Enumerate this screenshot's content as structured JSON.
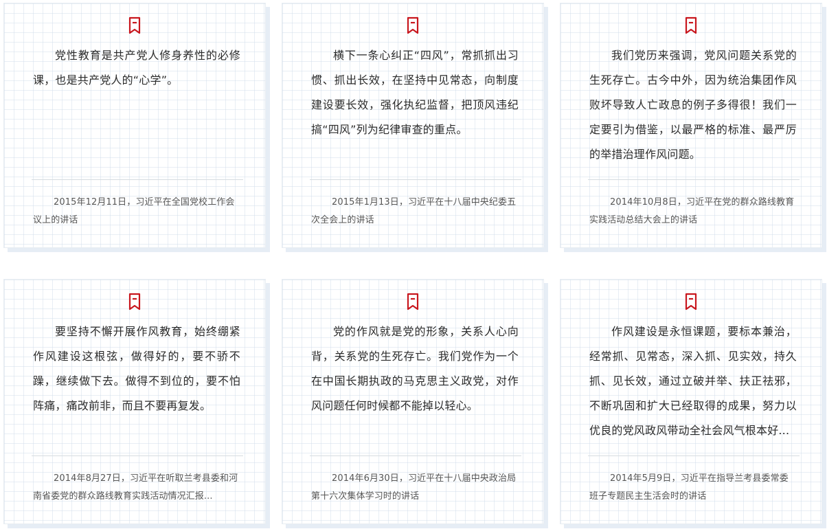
{
  "accent_color": "#c8161d",
  "icon": "bookmark-icon",
  "cards": [
    {
      "quote": "党性教育是共产党人修身养性的必修课，也是共产党人的“心学”。",
      "source": "2015年12月11日，习近平在全国党校工作会议上的讲话"
    },
    {
      "quote": "横下一条心纠正“四风”，常抓抓出习惯、抓出长效，在坚持中见常态，向制度建设要长效，强化执纪监督，把顶风违纪搞“四风”列为纪律审查的重点。",
      "source": "2015年1月13日，习近平在十八届中央纪委五次全会上的讲话"
    },
    {
      "quote": "我们党历来强调，党风问题关系党的生死存亡。古今中外，因为统治集团作风败坏导致人亡政息的例子多得很！我们一定要引为借鉴，以最严格的标准、最严厉的举措治理作风问题。",
      "source": "2014年10月8日，习近平在党的群众路线教育实践活动总结大会上的讲话"
    },
    {
      "quote": "要坚持不懈开展作风教育，始终绷紧作风建设这根弦，做得好的，要不骄不躁，继续做下去。做得不到位的，要不怕阵痛，痛改前非，而且不要再复发。",
      "source": "2014年8月27日，习近平在听取兰考县委和河南省委党的群众路线教育实践活动情况汇报..."
    },
    {
      "quote": "党的作风就是党的形象，关系人心向背，关系党的生死存亡。我们党作为一个在中国长期执政的马克思主义政党，对作风问题任何时候都不能掉以轻心。",
      "source": "2014年6月30日，习近平在十八届中央政治局第十六次集体学习时的讲话"
    },
    {
      "quote": "作风建设是永恒课题，要标本兼治，经常抓、见常态，深入抓、见实效，持久抓、见长效，通过立破并举、扶正祛邪，不断巩固和扩大已经取得的成果，努力以优良的党风政风带动全社会风气根本好...",
      "source": "2014年5月9日，习近平在指导兰考县委常委班子专题民主生活会时的讲话"
    }
  ]
}
